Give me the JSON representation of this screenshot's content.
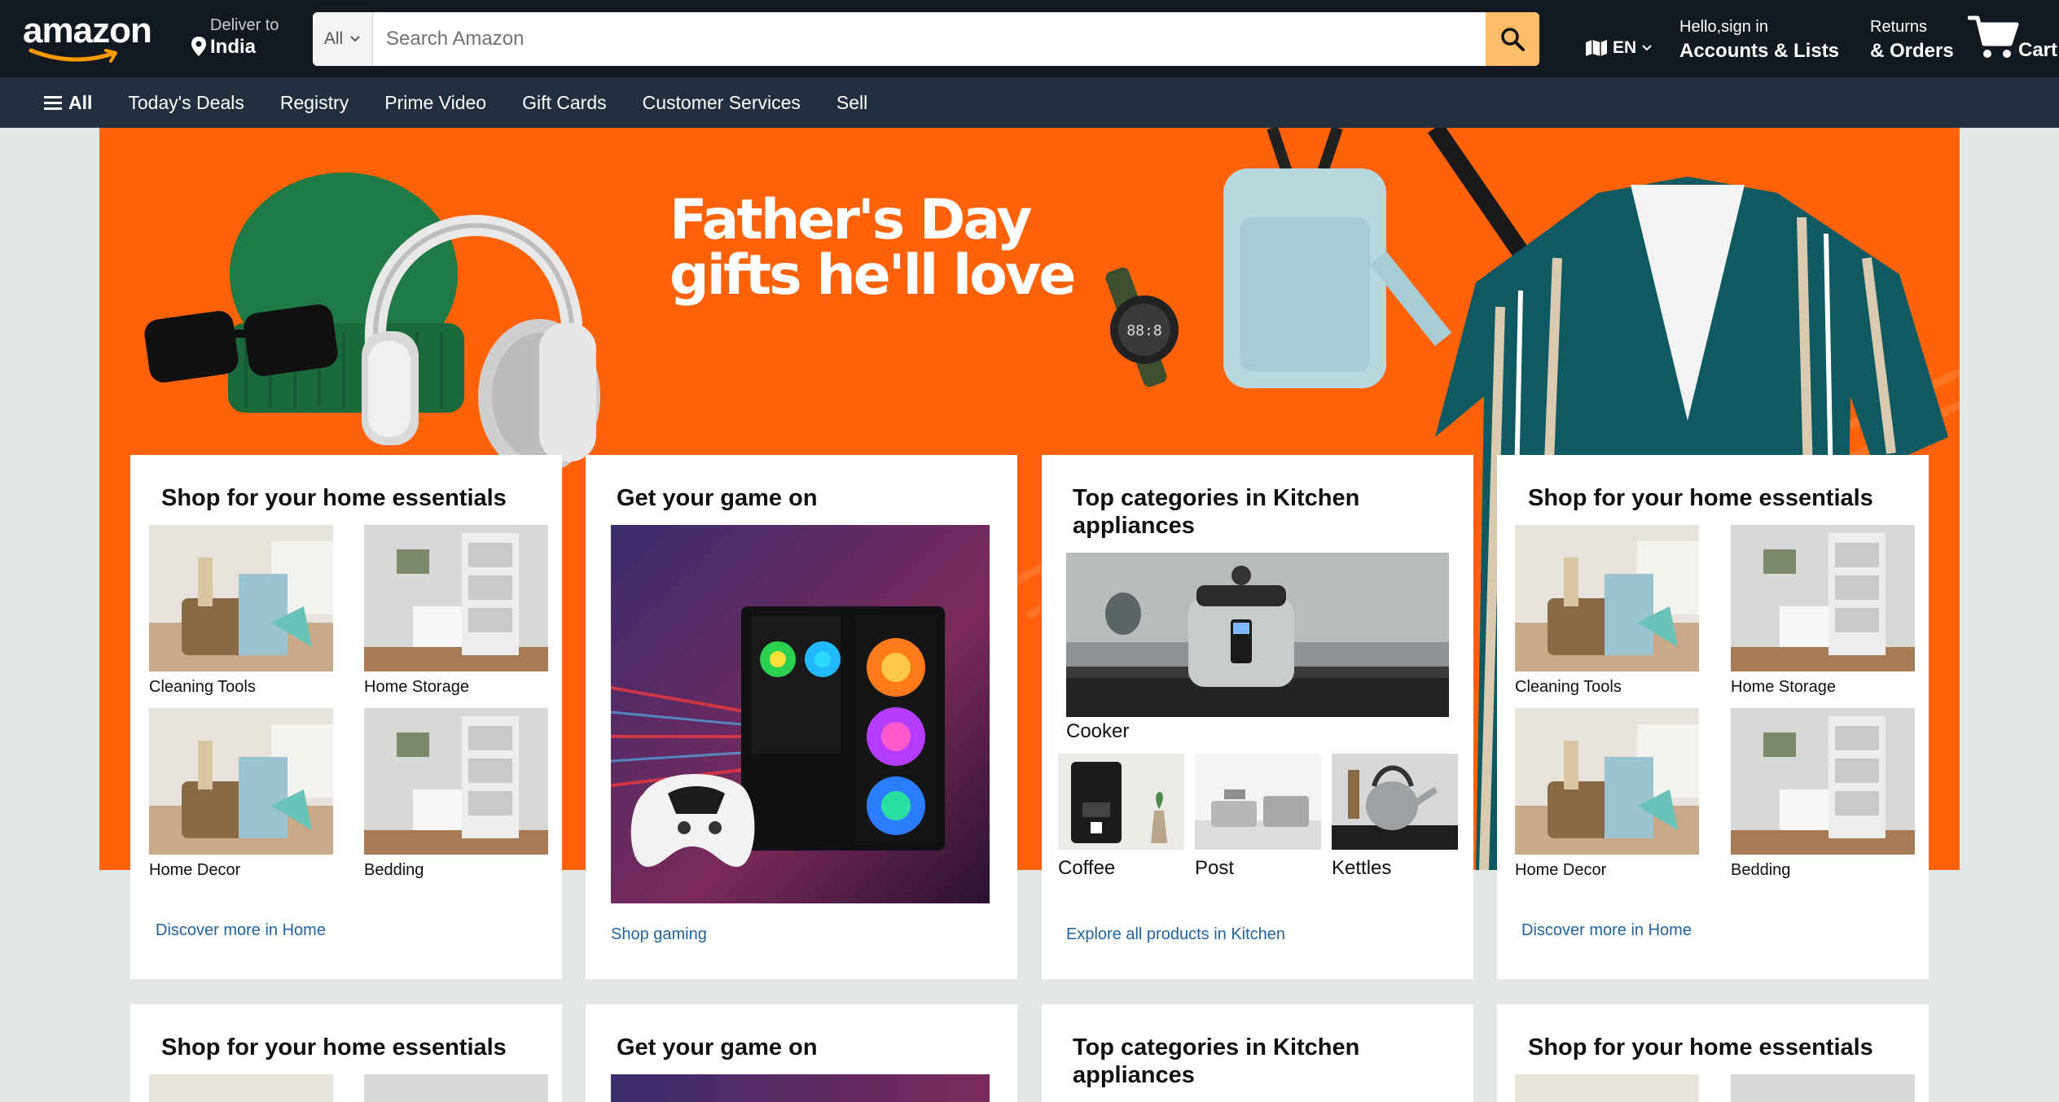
{
  "header": {
    "logo_text": "amazon",
    "deliver_small": "Deliver to",
    "deliver_big": "India",
    "search_category": "All",
    "search_placeholder": "Search Amazon",
    "language": "EN",
    "account_small": "Hello,sign in",
    "account_big": "Accounts & Lists",
    "returns_small": "Returns",
    "returns_big": "& Orders",
    "cart_label": "Cart"
  },
  "subnav": {
    "all": "All",
    "items": [
      "Today's Deals",
      "Registry",
      "Prime Video",
      "Gift Cards",
      "Customer Services",
      "Sell"
    ]
  },
  "hero": {
    "line1": "Father's Day",
    "line2": "gifts he'll love"
  },
  "cards_row1": {
    "home1": {
      "title": "Shop for your home essentials",
      "items": [
        "Cleaning Tools",
        "Home Storage",
        "Home Decor",
        "Bedding"
      ],
      "link": "Discover more in Home"
    },
    "game": {
      "title": "Get your game on",
      "link": "Shop gaming"
    },
    "kitchen": {
      "title": "Top categories in Kitchen appliances",
      "main_item": "Cooker",
      "items": [
        "Coffee",
        "Post",
        "Kettles"
      ],
      "link": "Explore all products in Kitchen"
    },
    "home2": {
      "title": "Shop for your home essentials",
      "items": [
        "Cleaning Tools",
        "Home Storage",
        "Home Decor",
        "Bedding"
      ],
      "link": "Discover more in Home"
    }
  },
  "cards_row2": {
    "home1_title": "Shop for your home essentials",
    "game_title": "Get your game on",
    "kitchen_title": "Top categories in Kitchen appliances",
    "home2_title": "Shop for your home essentials"
  },
  "colors": {
    "nav_dark": "#131921",
    "nav_sub": "#232f3e",
    "search_button": "#febd69",
    "hero_orange": "#ff6208",
    "link_blue": "#2162a1"
  }
}
